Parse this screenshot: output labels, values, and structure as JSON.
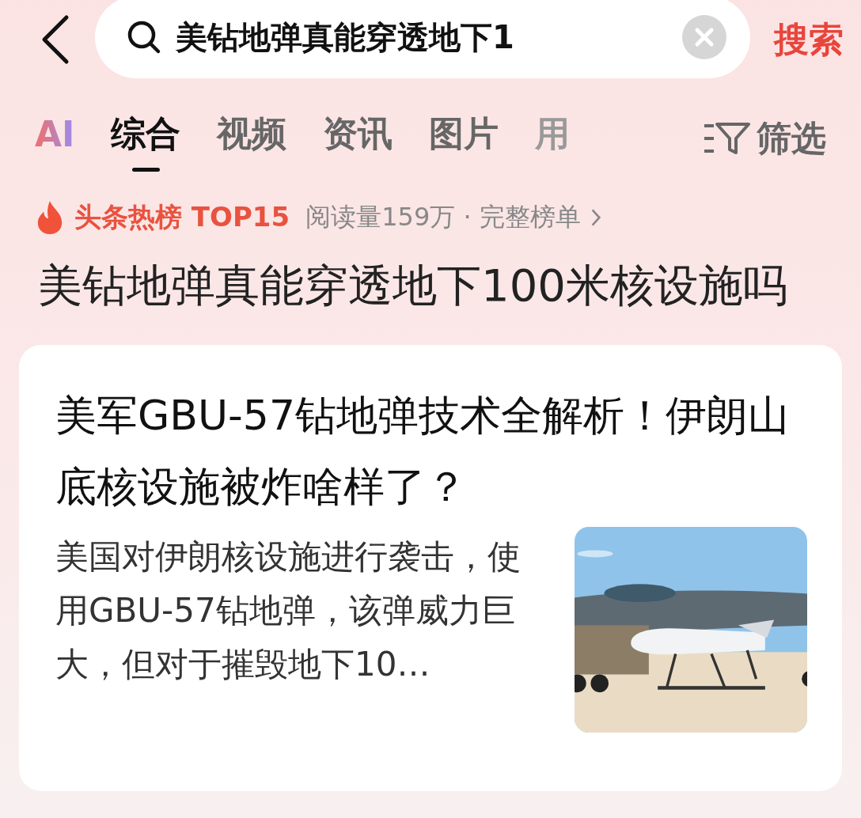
{
  "search": {
    "value": "美钻地弹真能穿透地下1",
    "button": "搜索"
  },
  "tabs": [
    {
      "label": "AI",
      "kind": "ai",
      "selected": false
    },
    {
      "label": "综合",
      "kind": "text",
      "selected": true
    },
    {
      "label": "视频",
      "kind": "text",
      "selected": false
    },
    {
      "label": "资讯",
      "kind": "text",
      "selected": false
    },
    {
      "label": "图片",
      "kind": "text",
      "selected": false
    },
    {
      "label": "用",
      "kind": "faded",
      "selected": false
    }
  ],
  "filter": {
    "label": "筛选"
  },
  "hot": {
    "label": "头条热榜 TOP15",
    "stats": "阅读量159万 · 完整榜单"
  },
  "headline": "美钻地弹真能穿透地下100米核设施吗",
  "card": {
    "title": "美军GBU-57钻地弹技术全解析！伊朗山底核设施被炸啥样了？",
    "snippet": "美国对伊朗核设施进行袭击，使用GBU-57钻地弹，该弹威力巨大，但对于摧毁地下10…"
  }
}
